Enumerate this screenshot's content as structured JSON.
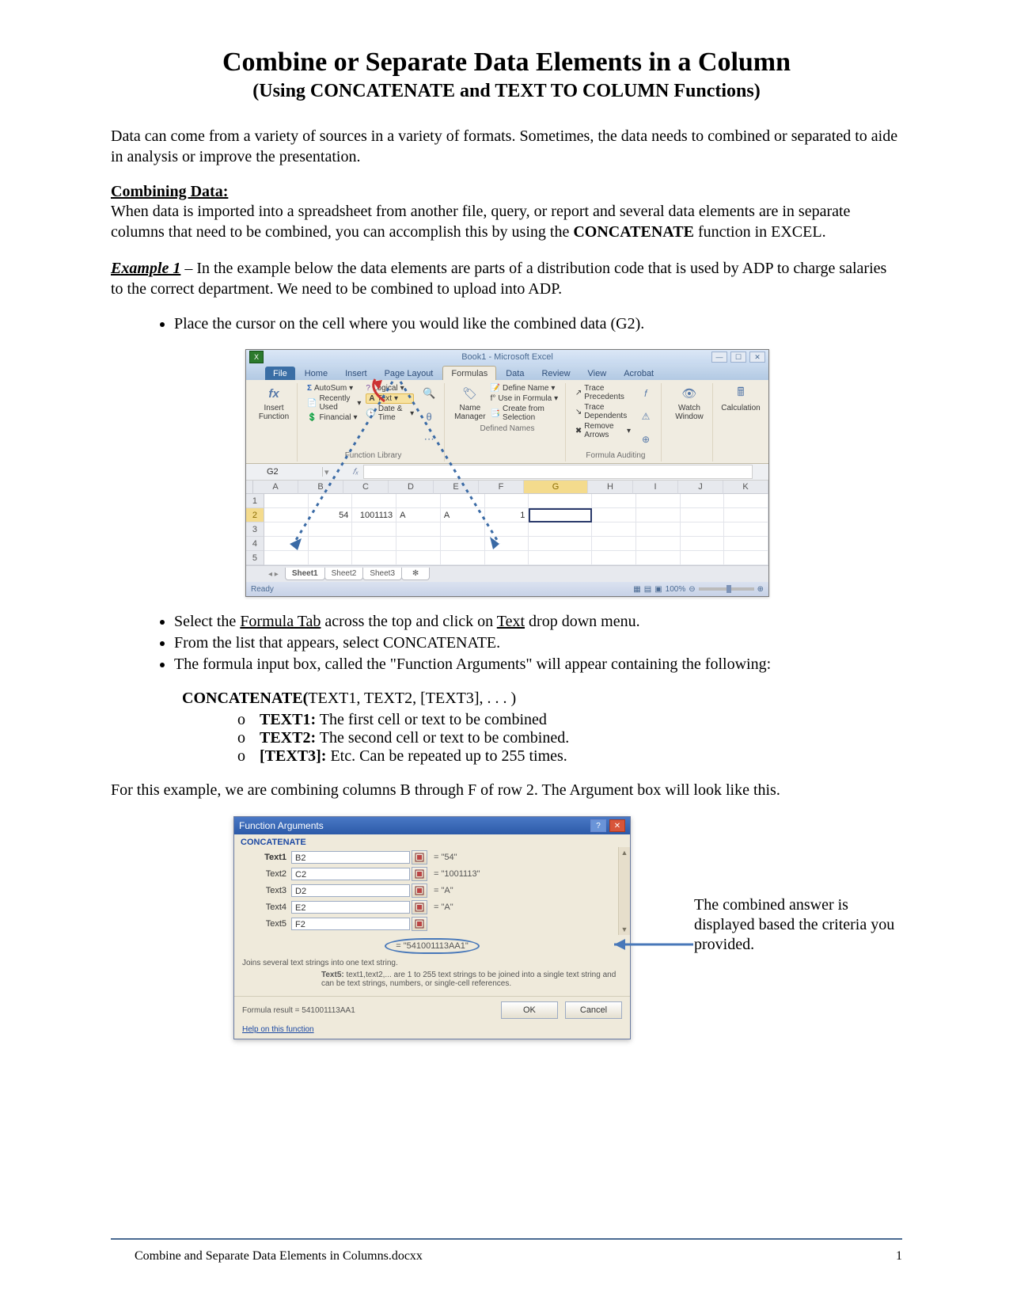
{
  "title": "Combine or Separate Data Elements in a Column",
  "subtitle": "(Using CONCATENATE and TEXT TO COLUMN Functions)",
  "intro": "Data can come from a variety of sources in a variety of formats.  Sometimes, the data needs to combined or separated to aide in analysis or improve the presentation.",
  "combining_heading": "Combining Data:",
  "combining_body_pre": "When data is imported into a spreadsheet from another file, query, or report and several data elements are in separate columns that need to be combined, you can accomplish this by using the ",
  "concat_word": "CONCATENATE",
  "combining_body_post": " function in EXCEL.",
  "example_label": "Example 1",
  "example_body": " – In the example below the data elements are parts of a distribution code that is used by ADP to charge salaries to the correct department. We need to be combined to upload into ADP.",
  "bullet1": "Place the cursor on the cell where you would like the combined data (G2).",
  "bullet2a": "Select the ",
  "bullet2b": "Formula Tab",
  "bullet2c": " across the top and click on ",
  "bullet2d": "Text",
  "bullet2e": " drop down menu.",
  "bullet3": "From the list that appears, select CONCATENATE.",
  "bullet4": "The formula input box, called the \"Function Arguments\" will appear containing the following:",
  "syntax_prefix": "CONCATENATE(",
  "syntax_rest": "TEXT1, TEXT2, [TEXT3], . . . )",
  "subs": [
    {
      "label": "TEXT1:",
      "text": " The first cell or text to be combined"
    },
    {
      "label": "TEXT2:",
      "text": " The second cell or text to be combined."
    },
    {
      "label": "[TEXT3]:",
      "text": " Etc. Can be repeated up to 255 times."
    }
  ],
  "for_example": "For this example, we are combining columns B through F of row 2.  The Argument box will look like this.",
  "excel": {
    "window_title": "Book1 - Microsoft Excel",
    "tabs": [
      "File",
      "Home",
      "Insert",
      "Page Layout",
      "Formulas",
      "Data",
      "Review",
      "View",
      "Acrobat"
    ],
    "ribbon": {
      "insert_fn": "Insert Function",
      "fx": "fx",
      "autosum": "AutoSum",
      "recent": "Recently Used",
      "financial": "Financial",
      "logical": "Logical",
      "text": "Text",
      "datetime": "Date & Time",
      "lib_cap": "Function Library",
      "name_mgr": "Name Manager",
      "def_name": "Define Name",
      "use_formula": "Use in Formula",
      "create_sel": "Create from Selection",
      "names_cap": "Defined Names",
      "trace_p": "Trace Precedents",
      "trace_d": "Trace Dependents",
      "remove_a": "Remove Arrows",
      "audit_cap": "Formula Auditing",
      "watch": "Watch Window",
      "calc": "Calculation"
    },
    "namebox": "G2",
    "columns": [
      "A",
      "B",
      "C",
      "D",
      "E",
      "F",
      "G",
      "H",
      "I",
      "J",
      "K"
    ],
    "row2": {
      "A": "",
      "B": "54",
      "C": "1001113",
      "D": "A",
      "E": "A",
      "F": "1",
      "G": ""
    },
    "sheets": [
      "Sheet1",
      "Sheet2",
      "Sheet3"
    ],
    "ready": "Ready",
    "zoom": "100%"
  },
  "fn": {
    "title": "Function Arguments",
    "cat": "CONCATENATE",
    "rows": [
      {
        "label": "Text1",
        "val": "B2",
        "eq": "= \"54\"",
        "bold": true
      },
      {
        "label": "Text2",
        "val": "C2",
        "eq": "= \"1001113\""
      },
      {
        "label": "Text3",
        "val": "D2",
        "eq": "= \"A\""
      },
      {
        "label": "Text4",
        "val": "E2",
        "eq": "= \"A\""
      },
      {
        "label": "Text5",
        "val": "F2",
        "eq": ""
      }
    ],
    "result_eq": "= \"541001113AA1\"",
    "desc": "Joins several text strings into one text string.",
    "argdesc_label": "Text5:",
    "argdesc_text": " text1,text2,... are 1 to 255 text strings to be joined into a single text string and can be text strings, numbers, or single-cell references.",
    "formula_res": "Formula result =  541001113AA1",
    "help": "Help on this function",
    "ok": "OK",
    "cancel": "Cancel"
  },
  "callout": "The combined answer is displayed based the criteria you provided.",
  "footer_file": "Combine and Separate Data Elements in Columns.docxx",
  "footer_page": "1"
}
